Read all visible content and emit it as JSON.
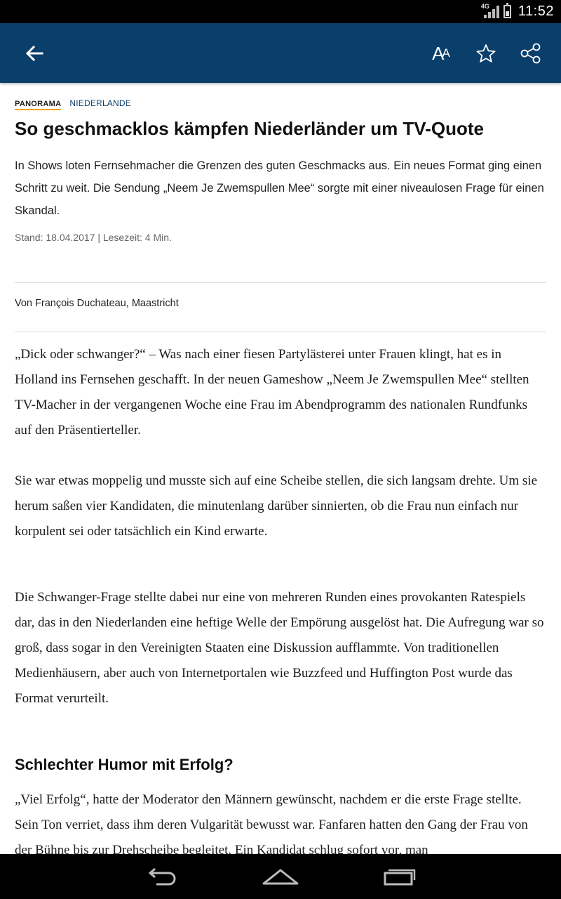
{
  "status_bar": {
    "network": "4G",
    "time": "11:52",
    "icons": [
      "signal-icon",
      "battery-icon"
    ]
  },
  "toolbar": {
    "back_icon": "arrow-left-icon",
    "font_size_icon": "font-size-icon",
    "font_size_big": "A",
    "font_size_small": "A",
    "favorite_icon": "star-icon",
    "share_icon": "share-icon",
    "background_color": "#0a3e6b"
  },
  "article": {
    "section": "PANORAMA",
    "topic": "NIEDERLANDE",
    "headline": "So geschmacklos kämpfen Niederländer um TV-Quote",
    "teaser": "In Shows loten Fernsehmacher die Grenzen des guten Geschmacks aus. Ein neues Format ging einen Schritt zu weit. Die Sendung „Neem Je Zwemspullen Mee“ sorgte mit einer niveaulosen Frage für einen Skandal.",
    "meta": "Stand: 18.04.2017 | Lesezeit: 4 Min.",
    "author": "Von François Duchateau, Maastricht",
    "paragraphs": [
      "„Dick oder schwanger?“ – Was nach einer fiesen Partylästerei unter Frauen klingt, hat es in Holland ins Fernsehen geschafft. In der neuen Gameshow „Neem Je Zwemspullen Mee“ stellten TV-Macher in der vergangenen Woche eine Frau im Abendprogramm des nationalen Rundfunks auf den Präsentierteller.",
      "Sie war etwas moppelig und musste sich auf eine Scheibe stellen, die sich langsam drehte. Um sie herum saßen vier Kandidaten, die minutenlang darüber sinnierten, ob die Frau nun einfach nur korpulent sei oder tatsächlich ein Kind erwarte.",
      "Die Schwanger-Frage stellte dabei nur eine von mehreren Runden eines provokanten Ratespiels dar, das in den Niederlanden eine heftige Welle der Empörung ausgelöst hat. Die Aufregung war so groß, dass sogar in den Vereinigten Staaten eine Diskussion aufflammte. Von traditionellen Medienhäusern, aber auch von Internetportalen wie Buzzfeed und Huffington Post wurde das Format verurteilt."
    ],
    "subheading": "Schlechter Humor mit Erfolg?",
    "paragraph_after_subheading": "„Viel Erfolg“, hatte der Moderator den Männern gewünscht, nachdem er die erste Frage stellte. Sein Ton verriet, dass ihm deren Vulgarität bewusst war. Fanfaren hatten den Gang der Frau von der Bühne bis zur Drehscheibe begleitet. Ein Kandidat schlug sofort vor, man"
  },
  "nav_bar": {
    "icons": [
      "back-nav-icon",
      "home-nav-icon",
      "recent-apps-icon"
    ]
  }
}
